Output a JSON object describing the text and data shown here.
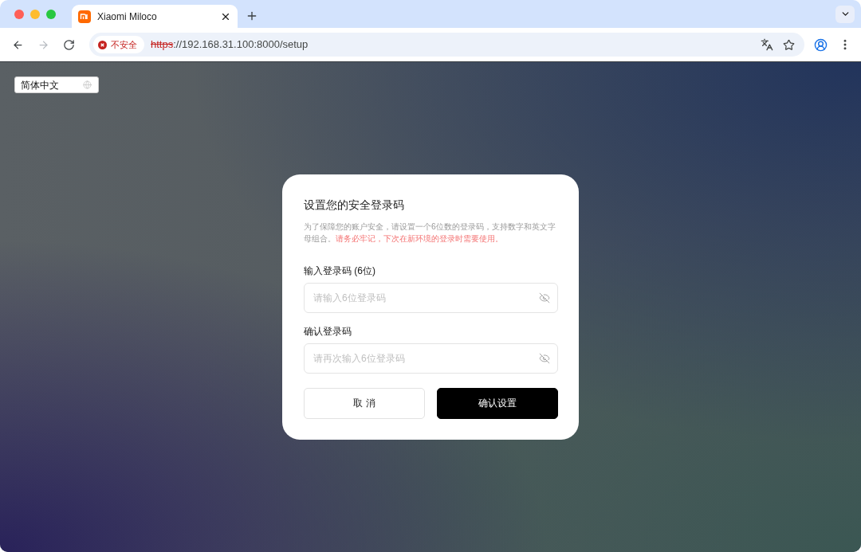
{
  "browser": {
    "tabs": [
      {
        "title": "Xiaomi Miloco",
        "selected": true
      }
    ],
    "nav_buttons": [
      {
        "kind": "back",
        "disabled": false
      },
      {
        "kind": "forward",
        "disabled": true
      },
      {
        "kind": "reload",
        "disabled": false
      }
    ],
    "security_chip": "不安全",
    "url": {
      "scheme": "https",
      "rest": "://192.168.31.100:8000/setup"
    }
  },
  "language_selector": {
    "value": "简体中文"
  },
  "dialog": {
    "title": "设置您的安全登录码",
    "description": "为了保障您的账户安全，请设置一个6位数的登录码，支持数字和英文字母组合。",
    "warning": "请务必牢记，下次在新环境的登录时需要使用。",
    "fields": [
      {
        "label": "输入登录码 (6位)",
        "placeholder": "请输入6位登录码"
      },
      {
        "label": "确认登录码",
        "placeholder": "请再次输入6位登录码"
      }
    ],
    "buttons": [
      {
        "label": "取 消",
        "kind": "secondary"
      },
      {
        "label": "确认设置",
        "kind": "primary"
      }
    ]
  }
}
